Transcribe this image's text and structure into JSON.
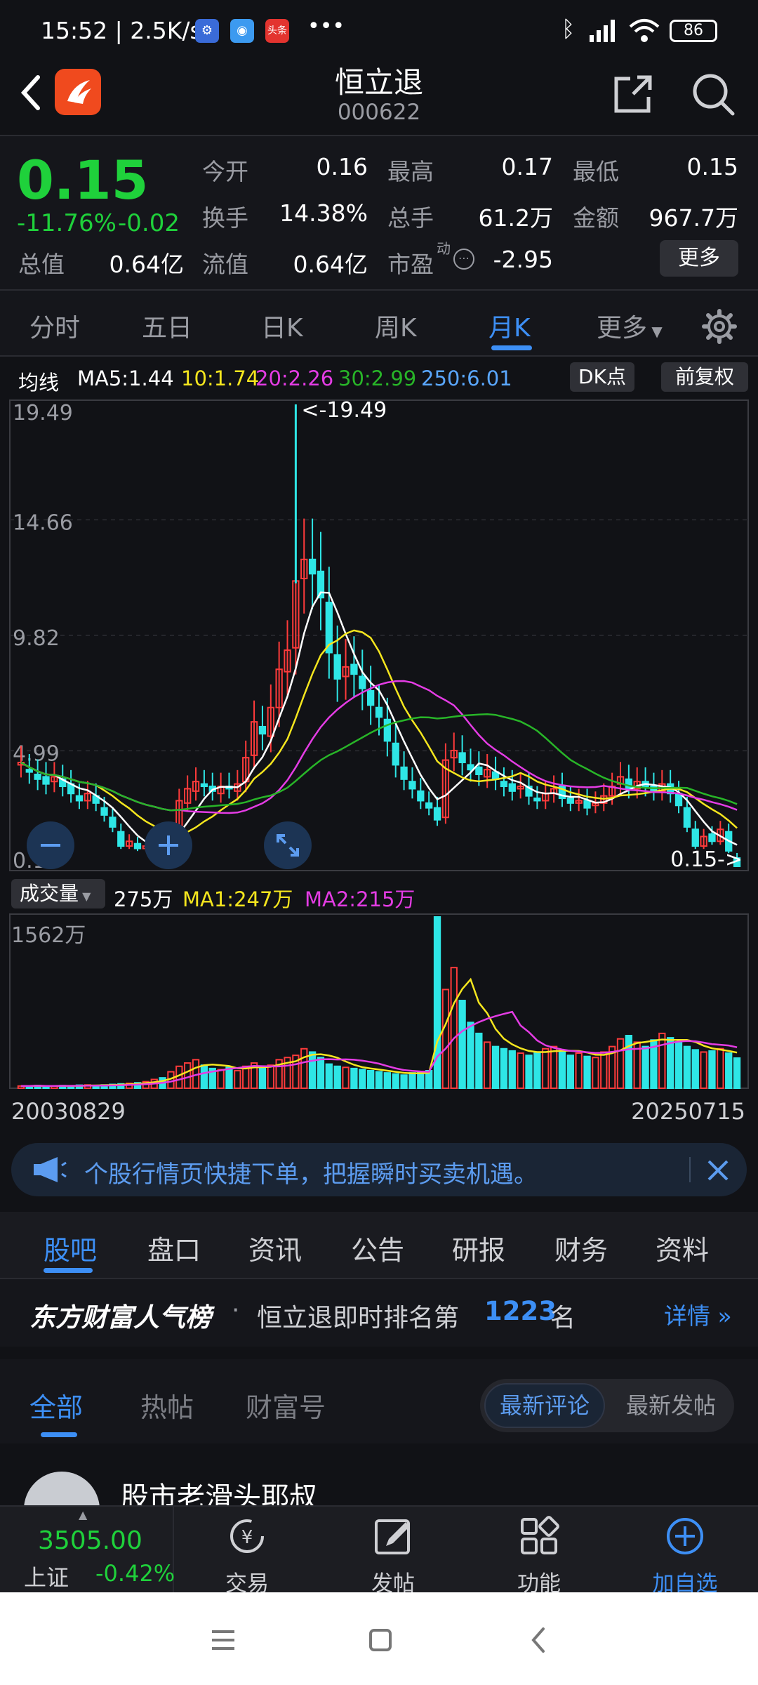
{
  "status_bar": {
    "time": "15:52",
    "speed": "2.5K/s",
    "battery": "86",
    "dots": "•••"
  },
  "header": {
    "title": "恒立退",
    "code": "000622"
  },
  "quote": {
    "price": "0.15",
    "change_pct": "-11.76%",
    "change_abs": "-0.02",
    "open_label": "今开",
    "open": "0.16",
    "high_label": "最高",
    "high": "0.17",
    "low_label": "最低",
    "low": "0.15",
    "turnover_label": "换手",
    "turnover": "14.38%",
    "volume_label": "总手",
    "volume": "61.2万",
    "amount_label": "金额",
    "amount": "967.7万",
    "mktcap_label": "总值",
    "mktcap": "0.64亿",
    "float_label": "流值",
    "float": "0.64亿",
    "pe_label": "市盈",
    "pe_sup": "动",
    "pe": "-2.95",
    "more_label": "更多"
  },
  "period_tabs": [
    "分时",
    "五日",
    "日K",
    "周K",
    "月K",
    "更多"
  ],
  "active_period": "月K",
  "ma_legend": {
    "label": "均线",
    "ma5": "MA5:1.44",
    "ma10": "10:1.74",
    "ma20": "20:2.26",
    "ma30": "30:2.99",
    "ma250": "250:6.01",
    "dk_label": "DK点",
    "adjust_label": "前复权"
  },
  "volume_legend": {
    "selector": "成交量",
    "vol": "275万",
    "ma1": "MA1:247万",
    "ma2": "MA2:215万"
  },
  "colors": {
    "up": "#ff3b3b",
    "down": "#2ee6e6",
    "ma5": "#ffffff",
    "ma10": "#f5e61e",
    "ma20": "#e43ce4",
    "ma30": "#28b528",
    "ma250": "#5aa7ff",
    "accent": "#3d8ff5"
  },
  "chart_data": [
    {
      "type": "candlestick",
      "title": "",
      "yticks": [
        "19.49",
        "14.66",
        "9.82",
        "4.99",
        "0.15"
      ],
      "ylim": [
        0.15,
        19.49
      ],
      "max_marker": "<-19.49",
      "last_marker": "0.15->",
      "grid": true,
      "points": [
        [
          4.4,
          4.5
        ],
        [
          4.2,
          4.1
        ],
        [
          4.0,
          3.8
        ],
        [
          3.9,
          3.6
        ],
        [
          3.7,
          3.9
        ],
        [
          3.8,
          3.5
        ],
        [
          3.6,
          3.2
        ],
        [
          3.1,
          2.9
        ],
        [
          2.9,
          3.2
        ],
        [
          3.1,
          2.8
        ],
        [
          2.6,
          2.3
        ],
        [
          2.2,
          1.8
        ],
        [
          1.6,
          1.0
        ],
        [
          1.0,
          1.2
        ],
        [
          1.1,
          0.9
        ],
        [
          0.9,
          1.0
        ],
        [
          1.0,
          1.3
        ],
        [
          1.3,
          1.0
        ],
        [
          1.2,
          1.4
        ],
        [
          1.4,
          2.9
        ],
        [
          2.8,
          3.4
        ],
        [
          3.3,
          3.7
        ],
        [
          3.6,
          3.5
        ],
        [
          3.5,
          3.3
        ],
        [
          3.2,
          3.5
        ],
        [
          3.5,
          3.4
        ],
        [
          3.3,
          3.6
        ],
        [
          3.7,
          4.7
        ],
        [
          4.8,
          6.2
        ],
        [
          6.0,
          5.7
        ],
        [
          5.6,
          6.8
        ],
        [
          6.8,
          8.4
        ],
        [
          8.3,
          9.2
        ],
        [
          9.3,
          12.1
        ],
        [
          12.2,
          13.0
        ],
        [
          13.0,
          12.4
        ],
        [
          12.5,
          11.4
        ],
        [
          11.2,
          9.1
        ],
        [
          9.0,
          8.0
        ],
        [
          8.1,
          8.5
        ],
        [
          8.6,
          8.2
        ],
        [
          8.1,
          7.6
        ],
        [
          7.5,
          6.9
        ],
        [
          6.8,
          6.4
        ],
        [
          6.3,
          5.4
        ],
        [
          5.3,
          4.4
        ],
        [
          4.3,
          3.8
        ],
        [
          3.7,
          3.4
        ],
        [
          3.3,
          2.9
        ],
        [
          2.8,
          2.6
        ],
        [
          2.6,
          2.1
        ],
        [
          2.2,
          4.6
        ],
        [
          4.7,
          5.0
        ],
        [
          4.9,
          4.5
        ],
        [
          4.4,
          4.2
        ],
        [
          4.3,
          4.0
        ],
        [
          3.9,
          4.2
        ],
        [
          4.1,
          3.8
        ],
        [
          3.7,
          3.5
        ],
        [
          3.6,
          3.3
        ],
        [
          3.4,
          3.5
        ],
        [
          3.5,
          3.1
        ],
        [
          3.0,
          2.9
        ],
        [
          2.9,
          3.2
        ],
        [
          3.2,
          3.4
        ],
        [
          3.5,
          3.0
        ],
        [
          3.0,
          2.8
        ],
        [
          2.8,
          2.9
        ],
        [
          2.9,
          2.6
        ],
        [
          2.7,
          2.8
        ],
        [
          2.8,
          3.1
        ],
        [
          3.1,
          3.5
        ],
        [
          3.6,
          3.9
        ],
        [
          3.8,
          3.4
        ],
        [
          3.4,
          3.7
        ],
        [
          3.7,
          3.5
        ],
        [
          3.5,
          3.3
        ],
        [
          3.3,
          3.6
        ],
        [
          3.6,
          3.2
        ],
        [
          3.2,
          2.7
        ],
        [
          2.6,
          1.8
        ],
        [
          1.7,
          1.0
        ],
        [
          1.0,
          1.4
        ],
        [
          1.5,
          1.2
        ],
        [
          1.2,
          1.7
        ],
        [
          1.6,
          0.8
        ],
        [
          0.5,
          0.15
        ]
      ]
    },
    {
      "type": "bar",
      "title": "",
      "yticks": [
        "1562万"
      ],
      "ylim": [
        0,
        1562
      ],
      "start_date": "20030829",
      "end_date": "20250715",
      "values": [
        20,
        22,
        25,
        18,
        20,
        24,
        22,
        28,
        30,
        25,
        30,
        35,
        40,
        45,
        50,
        60,
        80,
        95,
        150,
        200,
        230,
        260,
        210,
        180,
        170,
        190,
        160,
        200,
        230,
        180,
        210,
        260,
        280,
        300,
        360,
        330,
        280,
        220,
        200,
        190,
        180,
        170,
        160,
        150,
        140,
        130,
        120,
        140,
        150,
        160,
        1562,
        900,
        1100,
        800,
        600,
        500,
        420,
        380,
        360,
        340,
        320,
        300,
        330,
        360,
        380,
        340,
        300,
        320,
        290,
        280,
        330,
        380,
        450,
        480,
        420,
        380,
        440,
        500,
        460,
        420,
        380,
        350,
        330,
        340,
        360,
        320,
        275
      ]
    }
  ],
  "banner": {
    "text": "个股行情页快捷下单，把握瞬时买卖机遇。"
  },
  "info_tabs": [
    "股吧",
    "盘口",
    "资讯",
    "公告",
    "研报",
    "财务",
    "资料"
  ],
  "rank": {
    "brand": "东方财富人气榜",
    "dot": "·",
    "prefix": "恒立退即时排名第",
    "value": "1223",
    "suffix": "名",
    "detail": "详情"
  },
  "post_tabs": [
    "全部",
    "热帖",
    "财富号"
  ],
  "sort": {
    "latest_comment": "最新评论",
    "latest_post": "最新发帖"
  },
  "post": {
    "author": "股市老滑头耶叔"
  },
  "bottom_nav": {
    "index_value": "3505.00",
    "index_name": "上证",
    "index_change": "-0.42%",
    "trade": "交易",
    "post": "发帖",
    "functions": "功能",
    "add_watch": "加自选"
  }
}
